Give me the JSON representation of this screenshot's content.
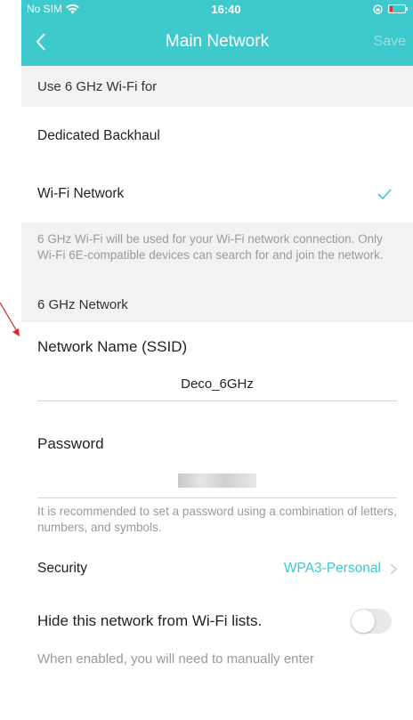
{
  "status_bar": {
    "carrier": "No SIM",
    "time": "16:40"
  },
  "nav": {
    "title": "Main Network",
    "save_label": "Save"
  },
  "use_6ghz": {
    "header": "Use 6 GHz Wi-Fi for",
    "option_backhaul": "Dedicated Backhaul",
    "option_wifi": "Wi-Fi Network",
    "selected": "Wi-Fi Network",
    "note": "6 GHz Wi-Fi will be used for your Wi-Fi network connection. Only Wi-Fi 6E-compatible devices can search for and join the network."
  },
  "network_6ghz": {
    "header": "6 GHz Network",
    "ssid_label": "Network Name (SSID)",
    "ssid_value": "Deco_6GHz",
    "password_label": "Password",
    "password_note": "It is recommended to set a password using a combination of letters, numbers, and symbols.",
    "security_label": "Security",
    "security_value": "WPA3-Personal",
    "hide_label": "Hide this network from Wi-Fi lists.",
    "hide_enabled": false,
    "hide_note": "When enabled, you will need to manually enter"
  },
  "colors": {
    "accent": "#3ec9cc",
    "marker": "#d6262b"
  }
}
